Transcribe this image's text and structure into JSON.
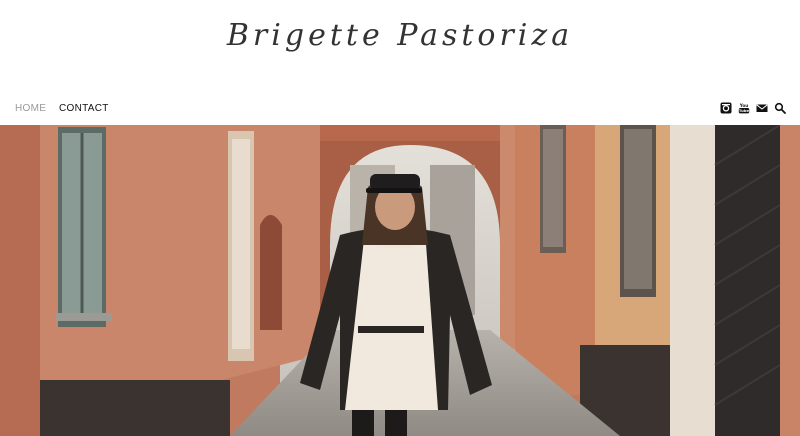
{
  "site": {
    "title": "Brigette Pastoriza"
  },
  "nav": {
    "items": [
      {
        "label": "Home",
        "active": true
      },
      {
        "label": "Contact",
        "active": false
      }
    ]
  },
  "social": {
    "icons": [
      "instagram-icon",
      "youtube-icon",
      "mail-icon",
      "search-icon"
    ]
  },
  "colors": {
    "nav_active": "#9a9a9a",
    "nav_text": "#111111",
    "wall": "#c9866a",
    "wall_shadow": "#a45f47"
  }
}
